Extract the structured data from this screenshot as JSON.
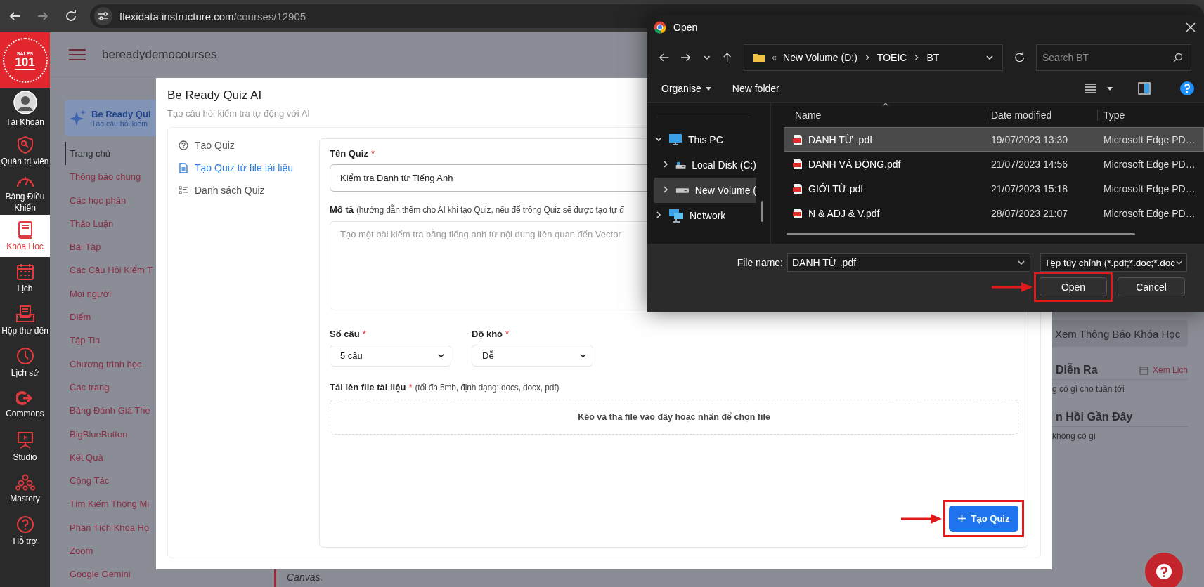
{
  "browser": {
    "url_host": "flexidata.instructure.com",
    "url_path": "/courses/12905"
  },
  "global_nav": {
    "logo": {
      "top": "SALES",
      "number": "101"
    },
    "items": [
      {
        "label": "Tài Khoản",
        "kind": "avatar",
        "selected": false
      },
      {
        "label": "Quản trị viên",
        "kind": "shield",
        "selected": false
      },
      {
        "label": "Bảng Điều Khiển",
        "kind": "gauge",
        "selected": false
      },
      {
        "label": "Khóa Học",
        "kind": "book",
        "selected": true
      },
      {
        "label": "Lịch",
        "kind": "calendar",
        "selected": false
      },
      {
        "label": "Hộp thư đến",
        "kind": "inbox",
        "selected": false
      },
      {
        "label": "Lịch sử",
        "kind": "clock",
        "selected": false
      },
      {
        "label": "Commons",
        "kind": "share",
        "selected": false
      },
      {
        "label": "Studio",
        "kind": "studio",
        "selected": false
      },
      {
        "label": "Mastery",
        "kind": "mastery",
        "selected": false
      },
      {
        "label": "Hỗ trợ",
        "kind": "help",
        "selected": false
      }
    ]
  },
  "course_header": {
    "title": "bereadydemocourses"
  },
  "course_nav": {
    "promo": {
      "title": "Be Ready Qui",
      "subtitle": "Tạo câu hỏi kiểm"
    },
    "items": [
      {
        "label": "Trang chủ",
        "selected": true
      },
      {
        "label": "Thông báo chung",
        "selected": false
      },
      {
        "label": "Các học phần",
        "selected": false
      },
      {
        "label": "Thảo Luận",
        "selected": false
      },
      {
        "label": "Bài Tập",
        "selected": false
      },
      {
        "label": "Các Câu Hỏi Kiểm T",
        "selected": false
      },
      {
        "label": "Mọi người",
        "selected": false
      },
      {
        "label": "Điểm",
        "selected": false
      },
      {
        "label": "Tập Tin",
        "selected": false
      },
      {
        "label": "Chương trình học",
        "selected": false
      },
      {
        "label": "Các trang",
        "selected": false
      },
      {
        "label": "Bảng Đánh Giá The",
        "selected": false
      },
      {
        "label": "BigBlueButton",
        "selected": false
      },
      {
        "label": "Kết Quả",
        "selected": false
      },
      {
        "label": "Cộng Tác",
        "selected": false
      },
      {
        "label": "Tìm Kiếm Thông Mi",
        "selected": false
      },
      {
        "label": "Phân Tích Khóa Họ",
        "selected": false
      },
      {
        "label": "Zoom",
        "selected": false
      },
      {
        "label": "Google Gemini",
        "selected": false
      }
    ]
  },
  "main": {
    "footnote": "Canvas."
  },
  "sidebar": {
    "announcements_button": "Xem Thông Báo Khóa Học",
    "upcoming": {
      "title": "Diễn Ra",
      "link": "Xem Lịch",
      "empty": "g có gì cho tuần tới"
    },
    "feedback": {
      "title": "n Hồi Gần Đây",
      "empty": "không có gì"
    }
  },
  "quiz_modal": {
    "title": "Be Ready Quiz AI",
    "subtitle": "Tạo câu hỏi kiểm tra tự động với AI",
    "menu": [
      {
        "label": "Tạo Quiz",
        "kind": "help",
        "selected": false
      },
      {
        "label": "Tạo Quiz từ file tài liệu",
        "kind": "document",
        "selected": true
      },
      {
        "label": "Danh sách Quiz",
        "kind": "list",
        "selected": false
      }
    ],
    "form": {
      "name": {
        "label": "Tên Quiz",
        "required_mark": "*",
        "value": "Kiểm tra Danh từ Tiếng Anh"
      },
      "description": {
        "label": "Mô tả",
        "hint": "(hướng dẫn thêm cho AI khi tạo Quiz, nếu để trống Quiz sẽ được tạo tự đ",
        "placeholder": "Tạo một bài kiểm tra bằng tiếng anh từ nội dung liên quan đến Vector"
      },
      "count": {
        "label": "Số câu",
        "required_mark": "*",
        "value": "5 câu"
      },
      "difficulty": {
        "label": "Độ khó",
        "required_mark": "*",
        "value": "Dễ"
      },
      "upload": {
        "label": "Tải lên file tài liệu",
        "required_mark": "*",
        "hint": "(tối đa 5mb, định dạng: docs, docx, pdf)",
        "dropzone": "Kéo và thả file vào đây hoặc nhấn để chọn file"
      },
      "submit": {
        "label": "Tạo Quiz",
        "highlighted": true
      }
    }
  },
  "file_dialog": {
    "title": "Open",
    "breadcrumb_overflow": "«",
    "breadcrumb": [
      "New Volume (D:)",
      "TOEIC",
      "BT"
    ],
    "search": {
      "placeholder": "Search BT"
    },
    "toolbar": [
      "Organise",
      "New folder"
    ],
    "nav_tree": [
      {
        "label": "This PC",
        "kind": "pc",
        "expanded": true,
        "selected": false,
        "children": [
          {
            "label": "Local Disk (C:)",
            "kind": "disk",
            "expanded": false,
            "selected": false
          },
          {
            "label": "New Volume (",
            "kind": "drive",
            "expanded": false,
            "selected": true
          }
        ]
      },
      {
        "label": "Network",
        "kind": "network",
        "expanded": false,
        "selected": false
      }
    ],
    "columns": [
      "Name",
      "Date modified",
      "Type"
    ],
    "files": [
      {
        "name": "DANH TỪ .pdf",
        "date": "19/07/2023 13:30",
        "type": "Microsoft Edge PD…",
        "selected": true
      },
      {
        "name": "DANH VÀ ĐỘNG.pdf",
        "date": "21/07/2023 14:56",
        "type": "Microsoft Edge PD…",
        "selected": false
      },
      {
        "name": "GIỚI TỪ.pdf",
        "date": "21/07/2023 15:18",
        "type": "Microsoft Edge PD…",
        "selected": false
      },
      {
        "name": "N & ADJ & V.pdf",
        "date": "28/07/2023 21:07",
        "type": "Microsoft Edge PD…",
        "selected": false
      }
    ],
    "file_name": {
      "label": "File name:",
      "value": "DANH TỪ .pdf"
    },
    "filter": "Tệp tùy chỉnh (*.pdf;*.doc;*.doc",
    "buttons": [
      {
        "label": "Open",
        "highlighted": true
      },
      {
        "label": "Cancel",
        "highlighted": false
      }
    ]
  }
}
